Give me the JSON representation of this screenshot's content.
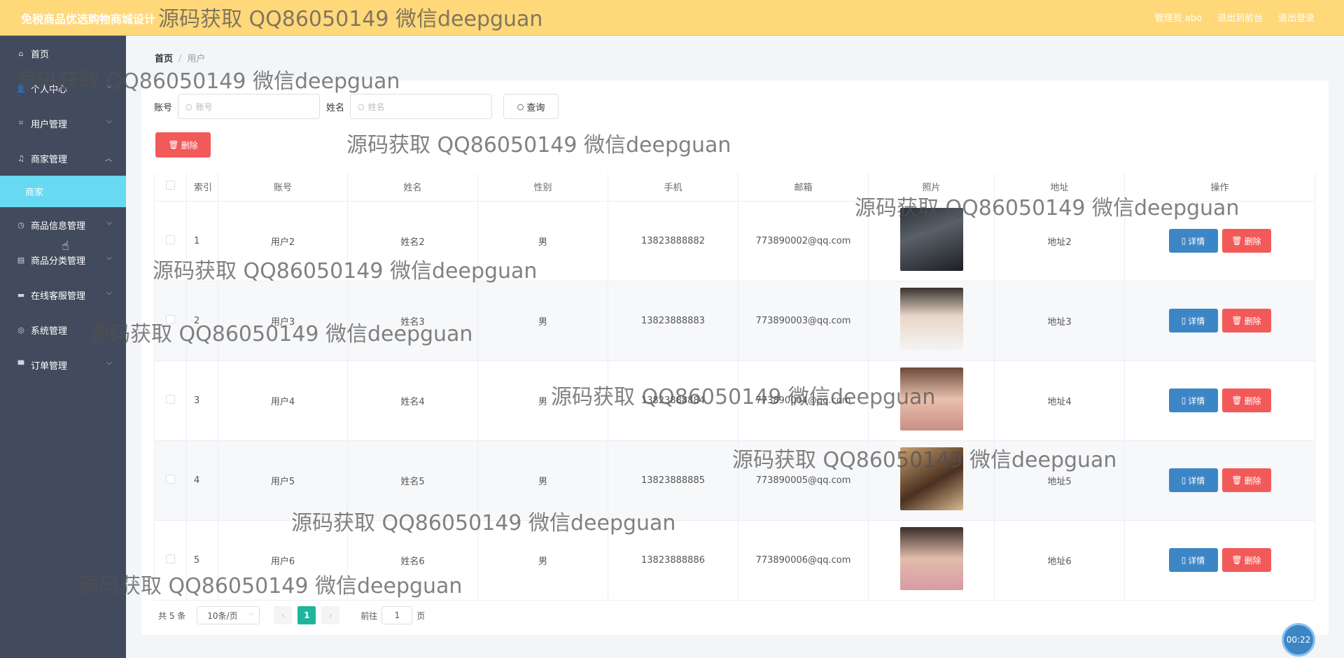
{
  "header": {
    "title": "免税商品优选购物商城设计",
    "user_label": "管理员 abo",
    "back_label": "退出到前台",
    "logout_label": "退出登录"
  },
  "sidebar": {
    "items": [
      {
        "label": "首页",
        "icon": "home-icon"
      },
      {
        "label": "个人中心",
        "icon": "user-icon"
      },
      {
        "label": "用户管理",
        "icon": "crop-icon"
      },
      {
        "label": "商家管理",
        "icon": "bell-icon",
        "sub": "商家"
      },
      {
        "label": "商品信息管理",
        "icon": "clock-icon"
      },
      {
        "label": "商品分类管理",
        "icon": "clipboard-icon"
      },
      {
        "label": "在线客服管理",
        "icon": "chat-icon"
      },
      {
        "label": "系统管理",
        "icon": "globe-icon"
      },
      {
        "label": "订单管理",
        "icon": "flag-icon"
      }
    ]
  },
  "breadcrumb": {
    "home": "首页",
    "current": "用户"
  },
  "search": {
    "account_label": "账号",
    "account_placeholder": "账号",
    "name_label": "姓名",
    "name_placeholder": "姓名",
    "query_label": "查询"
  },
  "delete_label": "删除",
  "table": {
    "headers": [
      "索引",
      "账号",
      "姓名",
      "性别",
      "手机",
      "邮箱",
      "照片",
      "地址",
      "操作"
    ],
    "rows": [
      {
        "index": "1",
        "account": "用户2",
        "name": "姓名2",
        "gender": "男",
        "phone": "13823888882",
        "email": "773890002@qq.com",
        "address": "地址2"
      },
      {
        "index": "2",
        "account": "用户3",
        "name": "姓名3",
        "gender": "男",
        "phone": "13823888883",
        "email": "773890003@qq.com",
        "address": "地址3"
      },
      {
        "index": "3",
        "account": "用户4",
        "name": "姓名4",
        "gender": "男",
        "phone": "13823888884",
        "email": "773890004@qq.com",
        "address": "地址4"
      },
      {
        "index": "4",
        "account": "用户5",
        "name": "姓名5",
        "gender": "男",
        "phone": "13823888885",
        "email": "773890005@qq.com",
        "address": "地址5"
      },
      {
        "index": "5",
        "account": "用户6",
        "name": "姓名6",
        "gender": "男",
        "phone": "13823888886",
        "email": "773890006@qq.com",
        "address": "地址6"
      }
    ],
    "detail_label": "详情",
    "delete_label": "删除"
  },
  "pagination": {
    "total": "共 5 条",
    "page_size": "10条/页",
    "current_page": "1",
    "goto_label": "前往",
    "goto_value": "1",
    "page_unit": "页"
  },
  "timer": "00:22",
  "watermark": "源码获取 QQ86050149 微信deepguan",
  "colors": {
    "header_bg": "#ffd87a",
    "sidebar_bg": "#424b5e",
    "active_sub_bg": "#67d9f0",
    "detail_button": "#3d86c6",
    "delete_button": "#f25a5a",
    "active_page": "#1fb59b"
  }
}
